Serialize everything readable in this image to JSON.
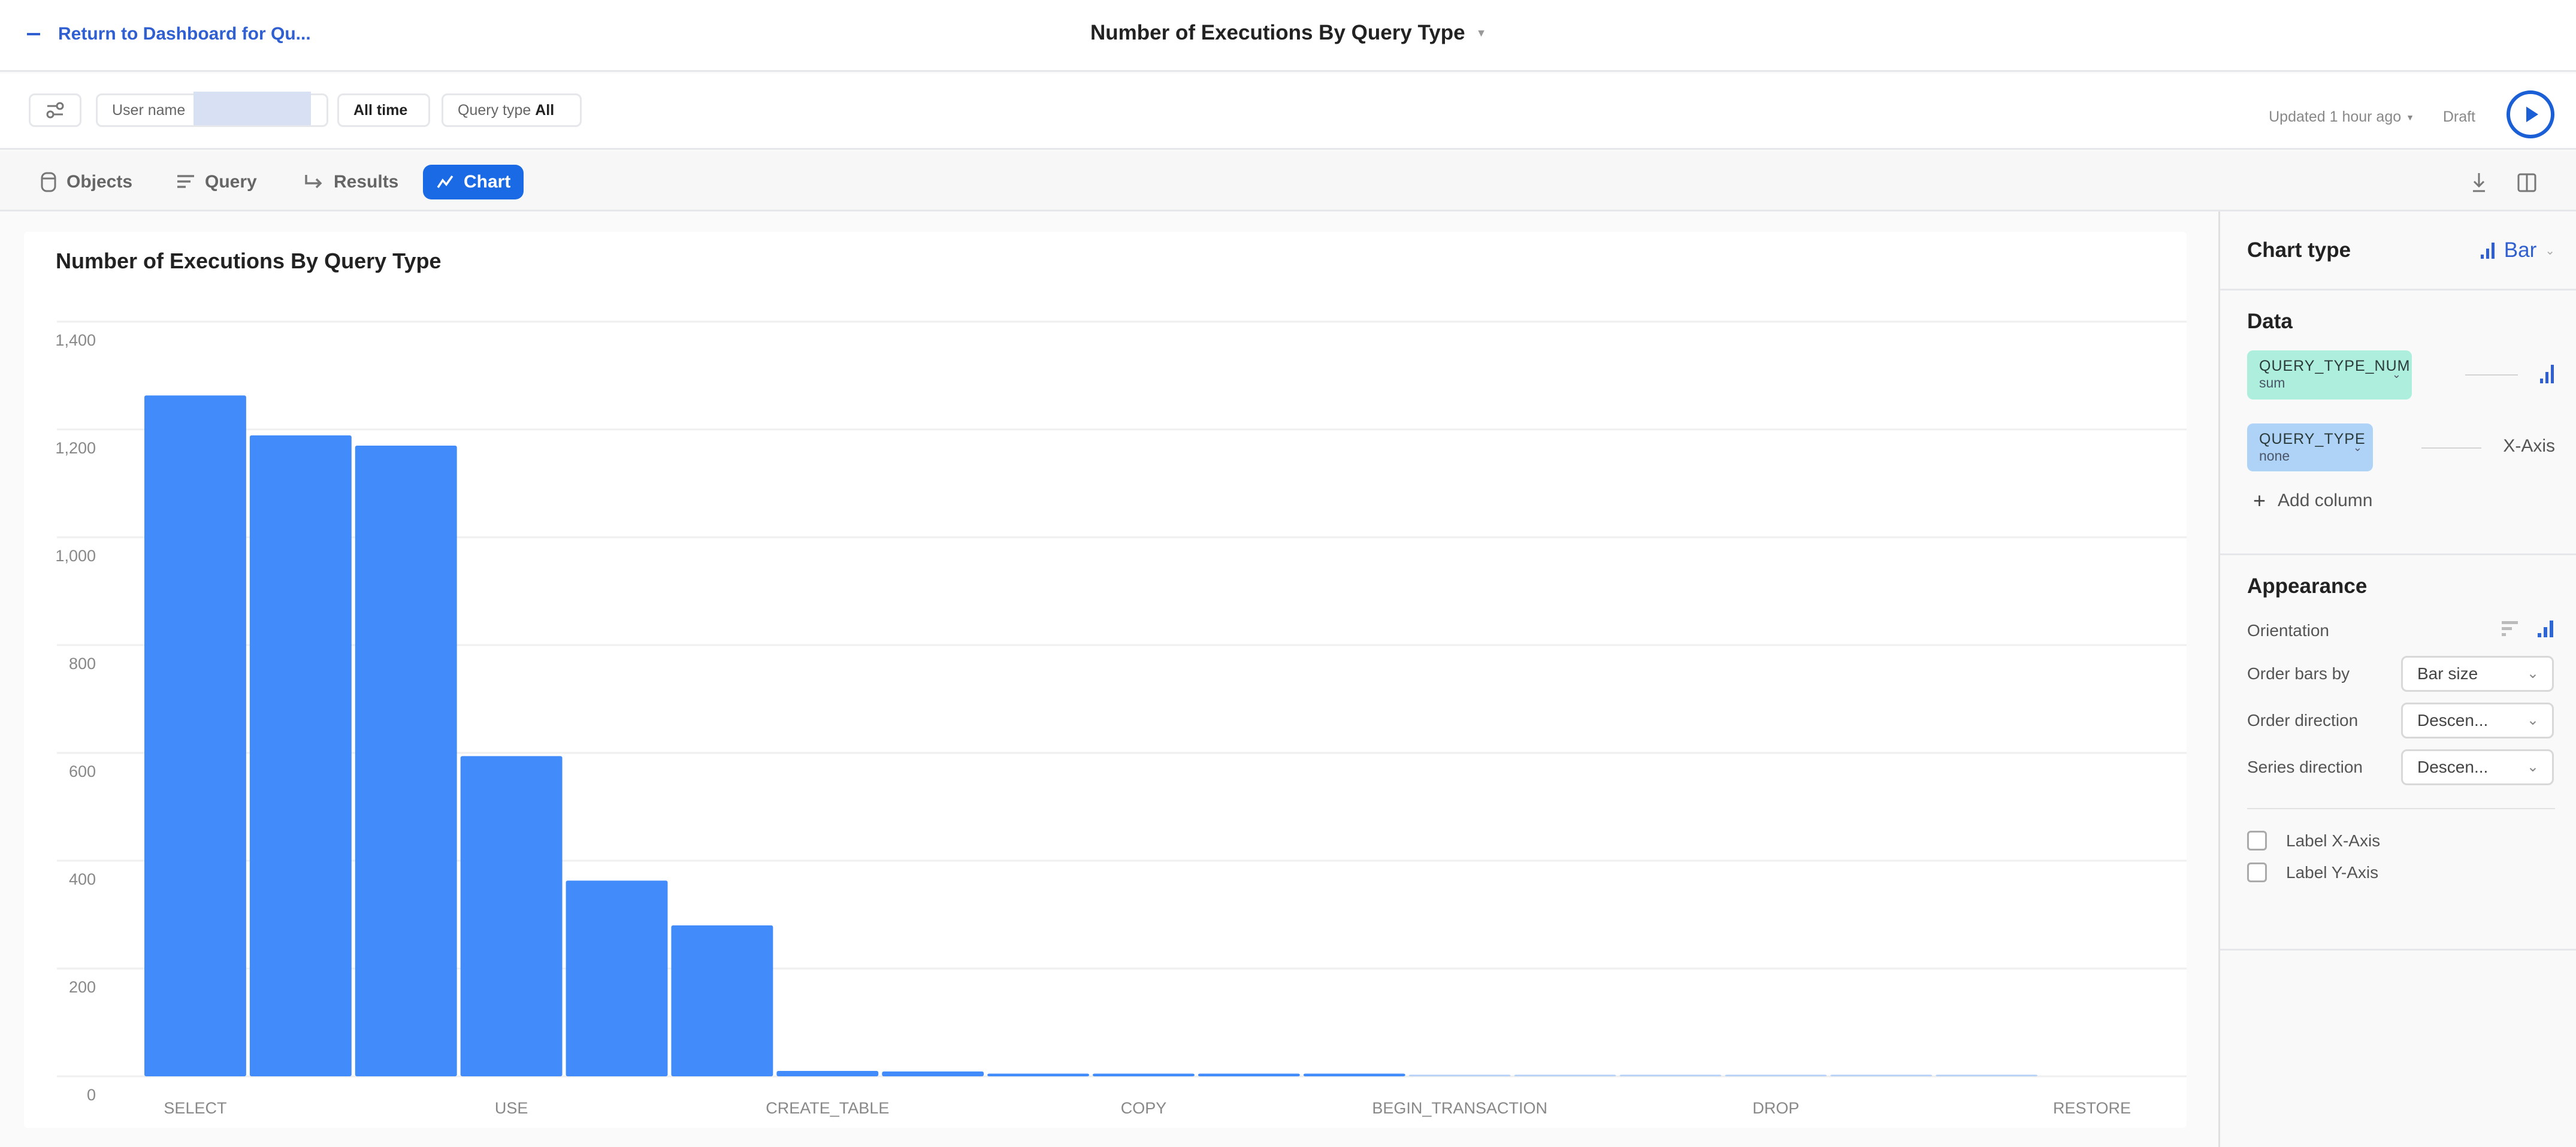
{
  "header": {
    "back_link": "Return to Dashboard for Qu...",
    "title": "Number of Executions By Query Type"
  },
  "filters": {
    "user_name_label": "User name",
    "time_label": "All time",
    "query_type_label": "Query type",
    "query_type_value": "All",
    "updated": "Updated 1 hour ago",
    "status": "Draft"
  },
  "tabs": [
    {
      "label": "Objects",
      "icon": "database-icon"
    },
    {
      "label": "Query",
      "icon": "lines-icon"
    },
    {
      "label": "Results",
      "icon": "arrow-return-icon"
    },
    {
      "label": "Chart",
      "icon": "line-chart-icon",
      "active": true
    }
  ],
  "colors": {
    "accent": "#1a6ae6",
    "bar": "#418bfb",
    "bar_light": "#b7d1f7",
    "measure_pill": "#adeedd",
    "dimension_pill": "#afd3f7"
  },
  "side_panel": {
    "chart_type": {
      "title": "Chart type",
      "value": "Bar"
    },
    "data": {
      "title": "Data",
      "columns": [
        {
          "name": "QUERY_TYPE_NUM",
          "aggregation": "sum",
          "role": "bar-icon"
        },
        {
          "name": "QUERY_TYPE",
          "aggregation": "none",
          "role": "X-Axis"
        }
      ],
      "add_column": "Add column"
    },
    "appearance": {
      "title": "Appearance",
      "orientation_label": "Orientation",
      "orientation_value": "vertical",
      "order_bars_by_label": "Order bars by",
      "order_bars_by_value": "Bar size",
      "order_direction_label": "Order direction",
      "order_direction_value": "Descen...",
      "series_direction_label": "Series direction",
      "series_direction_value": "Descen...",
      "label_x_axis": "Label X-Axis",
      "label_x_axis_checked": false,
      "label_y_axis": "Label Y-Axis",
      "label_y_axis_checked": false
    }
  },
  "chart_data": {
    "type": "bar",
    "title": "Number of Executions By Query Type",
    "xlabel": "",
    "ylabel": "",
    "ylim": [
      0,
      1400
    ],
    "yticks": [
      0,
      200,
      400,
      600,
      800,
      1000,
      1200,
      1400
    ],
    "ytick_labels": [
      "0",
      "200",
      "400",
      "600",
      "800",
      "1,000",
      "1,200",
      "1,400"
    ],
    "grid": true,
    "legend": "none",
    "categories": [
      "SELECT",
      "",
      "",
      "USE",
      "",
      "",
      "CREATE_TABLE",
      "",
      "",
      "COPY",
      "",
      "",
      "BEGIN_TRANSACTION",
      "",
      "",
      "DROP",
      "",
      "",
      "RESTORE"
    ],
    "values": [
      1263,
      1189,
      1170,
      594,
      363,
      280,
      10,
      9,
      5,
      5,
      5,
      5,
      3,
      3,
      3,
      3,
      3,
      3,
      0
    ]
  }
}
